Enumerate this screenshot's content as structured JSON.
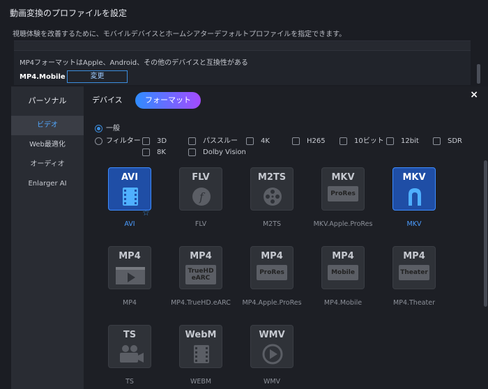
{
  "background_dialog": {
    "title": "動画変換のプロファイルを設定",
    "description": "視聴体験を改善するために、モバイルデバイスとホームシアターデフォルトプロファイルを指定できます。",
    "compat_text": "MP4フォーマットはApple、Android、その他のデバイスと互換性がある",
    "profile_name": "MP4.Mobile",
    "change_button": "変更"
  },
  "popup": {
    "close_label": "×",
    "sidebar": {
      "header": "パーソナル",
      "items": [
        {
          "label": "ビデオ",
          "active": true
        },
        {
          "label": "Web最適化",
          "active": false
        },
        {
          "label": "オーディオ",
          "active": false
        },
        {
          "label": "Enlarger AI",
          "active": false
        }
      ]
    },
    "tabs": [
      {
        "label": "デバイス",
        "active": false
      },
      {
        "label": "フォーマット",
        "active": true
      }
    ],
    "radios": [
      {
        "label": "一般",
        "selected": true
      },
      {
        "label": "フィルター",
        "selected": false
      }
    ],
    "filters": [
      "3D",
      "パススルー",
      "4K",
      "H265",
      "10ビット",
      "12bit",
      "SDR",
      "8K",
      "Dolby Vision"
    ],
    "formats": [
      {
        "tile": "AVI",
        "name": "AVI",
        "selected": true,
        "icon": "film-strip-icon"
      },
      {
        "tile": "FLV",
        "name": "FLV",
        "selected": false,
        "icon": "flash-icon"
      },
      {
        "tile": "M2TS",
        "name": "M2TS",
        "selected": false,
        "icon": "film-reel-icon"
      },
      {
        "tile": "MKV",
        "name": "MKV.Apple.ProRes",
        "selected": false,
        "tag": "ProRes"
      },
      {
        "tile": "MKV",
        "name": "MKV",
        "selected": true,
        "icon": "matroska-icon"
      },
      {
        "tile": "MP4",
        "name": "MP4",
        "selected": false,
        "icon": "play-icon"
      },
      {
        "tile": "MP4",
        "name": "MP4.TrueHD.eARC",
        "selected": false,
        "tag": "TrueHD eARC"
      },
      {
        "tile": "MP4",
        "name": "MP4.Apple.ProRes",
        "selected": false,
        "tag": "ProRes"
      },
      {
        "tile": "MP4",
        "name": "MP4.Mobile",
        "selected": false,
        "tag": "Mobile"
      },
      {
        "tile": "MP4",
        "name": "MP4.Theater",
        "selected": false,
        "tag": "Theater"
      },
      {
        "tile": "TS",
        "name": "TS",
        "selected": false,
        "icon": "camera-icon"
      },
      {
        "tile": "WebM",
        "name": "WEBM",
        "selected": false,
        "icon": "film-strip-icon"
      },
      {
        "tile": "WMV",
        "name": "WMV",
        "selected": false,
        "icon": "play-circle-icon"
      }
    ],
    "favorite_icon": "star-icon"
  },
  "colors": {
    "accent": "#3c8dde",
    "selected_tile": "#1f4ea6",
    "tab_gradient_start": "#2f8cff",
    "tab_gradient_end": "#a44bff"
  }
}
